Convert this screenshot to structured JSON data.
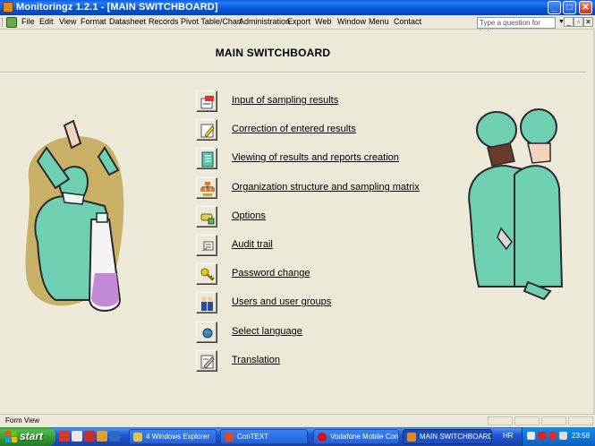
{
  "window": {
    "title": "Monitoringz 1.2.1 - [MAIN SWITCHBOARD]",
    "minimize_glyph": "_",
    "maximize_glyph": "□",
    "close_glyph": "✕"
  },
  "menu": {
    "items": [
      "File",
      "Edit",
      "View",
      "Format",
      "Datasheet",
      "Records",
      "Pivot Table/Chart",
      "Administration",
      "Export",
      "Web",
      "Window",
      "Menu",
      "Contact"
    ],
    "help_placeholder": "Type a question for help",
    "help_arrow": "▼",
    "mdi_minimize": "_",
    "mdi_restore": "▫",
    "mdi_close": "✕"
  },
  "form": {
    "title": "MAIN SWITCHBOARD",
    "items": [
      {
        "label": "Input of sampling results",
        "icon": "edit-form-icon"
      },
      {
        "label": "Correction of entered results",
        "icon": "correction-icon"
      },
      {
        "label": "Viewing of results and reports creation",
        "icon": "notebook-icon"
      },
      {
        "label": "Organization structure and sampling matrix ",
        "icon": "org-chart-icon"
      },
      {
        "label": "Options",
        "icon": "options-icon"
      },
      {
        "label": "Audit trail",
        "icon": "audit-trail-icon"
      },
      {
        "label": "Password change",
        "icon": "key-icon"
      },
      {
        "label": "Users and user groups",
        "icon": "users-icon"
      },
      {
        "label": "Select language",
        "icon": "globe-icon"
      },
      {
        "label": "Translation",
        "icon": "translation-icon"
      }
    ]
  },
  "status": {
    "text": "Form View"
  },
  "taskbar": {
    "start_label": "start",
    "tasks": [
      {
        "label": "4 Windows Explorer",
        "icon_color": "#e8c14a",
        "active": false
      },
      {
        "label": "ConTEXT",
        "icon_color": "#d84a2a",
        "active": false
      },
      {
        "label": "Vodafone Mobile Con...",
        "icon_color": "#d11",
        "active": false
      },
      {
        "label": "MAIN SWITCHBOARD",
        "icon_color": "#e08a1e",
        "active": true
      }
    ],
    "language": "HR",
    "clock": "23:58"
  }
}
